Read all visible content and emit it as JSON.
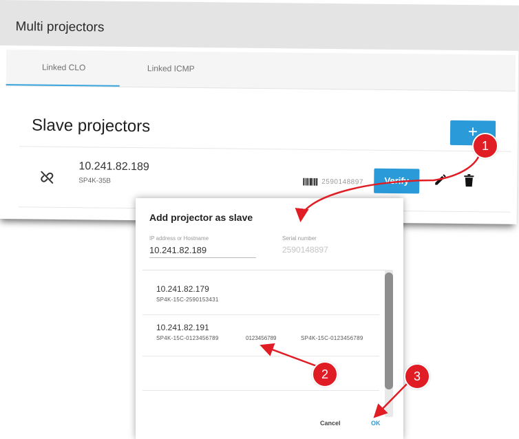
{
  "panel": {
    "title": "Multi projectors",
    "tabs": [
      {
        "label": "Linked CLO",
        "active": true
      },
      {
        "label": "Linked ICMP",
        "active": false
      }
    ],
    "section_title": "Slave projectors",
    "add_label": "+",
    "projector": {
      "ip": "10.241.82.189",
      "model": "SP4K-35B",
      "serial": "2590148897",
      "verify_label": "Verify"
    }
  },
  "dialog": {
    "title": "Add projector as slave",
    "ip_label": "IP address or Hostname",
    "ip_value": "10.241.82.189",
    "serial_label": "Serial number",
    "serial_value": "2590148897",
    "items": [
      {
        "ip": "10.241.82.179",
        "sub": "SP4K-15C-2590153431"
      },
      {
        "ip": "10.241.82.191",
        "sub": "SP4K-15C-0123456789",
        "serial": "0123456789",
        "name": "SP4K-15C-0123456789"
      }
    ],
    "cancel_label": "Cancel",
    "ok_label": "OK"
  },
  "callouts": [
    "1",
    "2",
    "3"
  ],
  "colors": {
    "accent": "#2a9bd8",
    "callout": "#e01c24",
    "header_bg": "#e4e4e4"
  },
  "icons": [
    "unlink-icon",
    "barcode-icon",
    "edit-icon",
    "trash-icon"
  ]
}
